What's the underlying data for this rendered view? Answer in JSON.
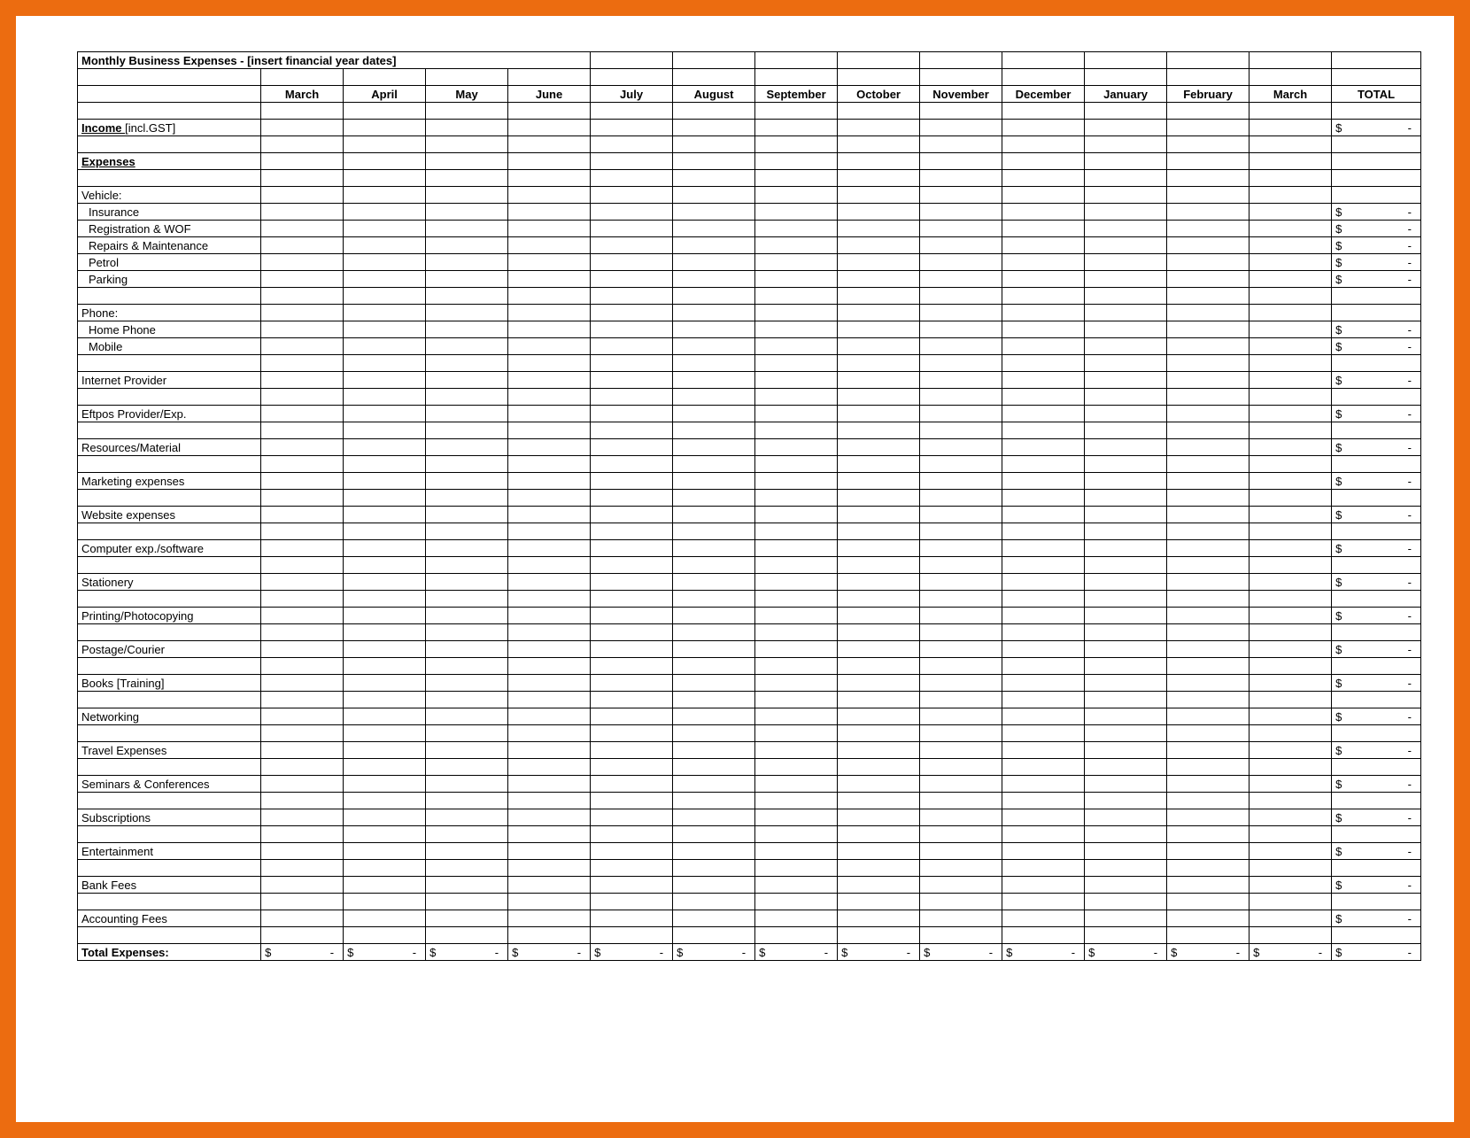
{
  "title": "Monthly Business Expenses - [insert financial year dates]",
  "months": [
    "March",
    "April",
    "May",
    "June",
    "July",
    "August",
    "September",
    "October",
    "November",
    "December",
    "January",
    "February",
    "March"
  ],
  "totalHeader": "TOTAL",
  "currency": "$",
  "dash": "-",
  "rows": [
    {
      "type": "blank"
    },
    {
      "type": "mixed",
      "label": "Income ",
      "suffix": "[incl.GST]",
      "total": true,
      "boldLabel": true,
      "underline": true
    },
    {
      "type": "blank"
    },
    {
      "type": "bold",
      "label": "Expenses",
      "underline": true
    },
    {
      "type": "blank"
    },
    {
      "type": "plain",
      "label": "Vehicle:"
    },
    {
      "type": "indent",
      "label": "Insurance",
      "total": true
    },
    {
      "type": "indent",
      "label": "Registration & WOF",
      "total": true
    },
    {
      "type": "indent",
      "label": "Repairs & Maintenance",
      "total": true
    },
    {
      "type": "indent",
      "label": "Petrol",
      "total": true
    },
    {
      "type": "indent",
      "label": "Parking",
      "total": true
    },
    {
      "type": "blank"
    },
    {
      "type": "plain",
      "label": "Phone:"
    },
    {
      "type": "indent",
      "label": "Home Phone",
      "total": true
    },
    {
      "type": "indent",
      "label": "Mobile",
      "total": true
    },
    {
      "type": "blank"
    },
    {
      "type": "plain",
      "label": "Internet Provider",
      "total": true
    },
    {
      "type": "blank"
    },
    {
      "type": "plain",
      "label": "Eftpos Provider/Exp.",
      "total": true
    },
    {
      "type": "blank"
    },
    {
      "type": "plain",
      "label": "Resources/Material",
      "total": true
    },
    {
      "type": "blank"
    },
    {
      "type": "plain",
      "label": "Marketing expenses",
      "total": true
    },
    {
      "type": "blank"
    },
    {
      "type": "plain",
      "label": "Website expenses",
      "total": true
    },
    {
      "type": "blank"
    },
    {
      "type": "plain",
      "label": "Computer exp./software",
      "total": true
    },
    {
      "type": "blank"
    },
    {
      "type": "plain",
      "label": "Stationery",
      "total": true
    },
    {
      "type": "blank"
    },
    {
      "type": "plain",
      "label": "Printing/Photocopying",
      "total": true
    },
    {
      "type": "blank"
    },
    {
      "type": "plain",
      "label": "Postage/Courier",
      "total": true
    },
    {
      "type": "blank"
    },
    {
      "type": "plain",
      "label": "Books [Training]",
      "total": true
    },
    {
      "type": "blank"
    },
    {
      "type": "plain",
      "label": "Networking",
      "total": true
    },
    {
      "type": "blank"
    },
    {
      "type": "plain",
      "label": "Travel Expenses",
      "total": true
    },
    {
      "type": "blank"
    },
    {
      "type": "plain",
      "label": "Seminars & Conferences",
      "total": true
    },
    {
      "type": "blank"
    },
    {
      "type": "plain",
      "label": "Subscriptions",
      "total": true
    },
    {
      "type": "blank"
    },
    {
      "type": "plain",
      "label": "Entertainment",
      "total": true
    },
    {
      "type": "blank"
    },
    {
      "type": "plain",
      "label": "Bank Fees",
      "total": true
    },
    {
      "type": "blank"
    },
    {
      "type": "plain",
      "label": "Accounting Fees",
      "total": true
    },
    {
      "type": "blank"
    },
    {
      "type": "totals",
      "label": "Total Expenses:"
    }
  ]
}
